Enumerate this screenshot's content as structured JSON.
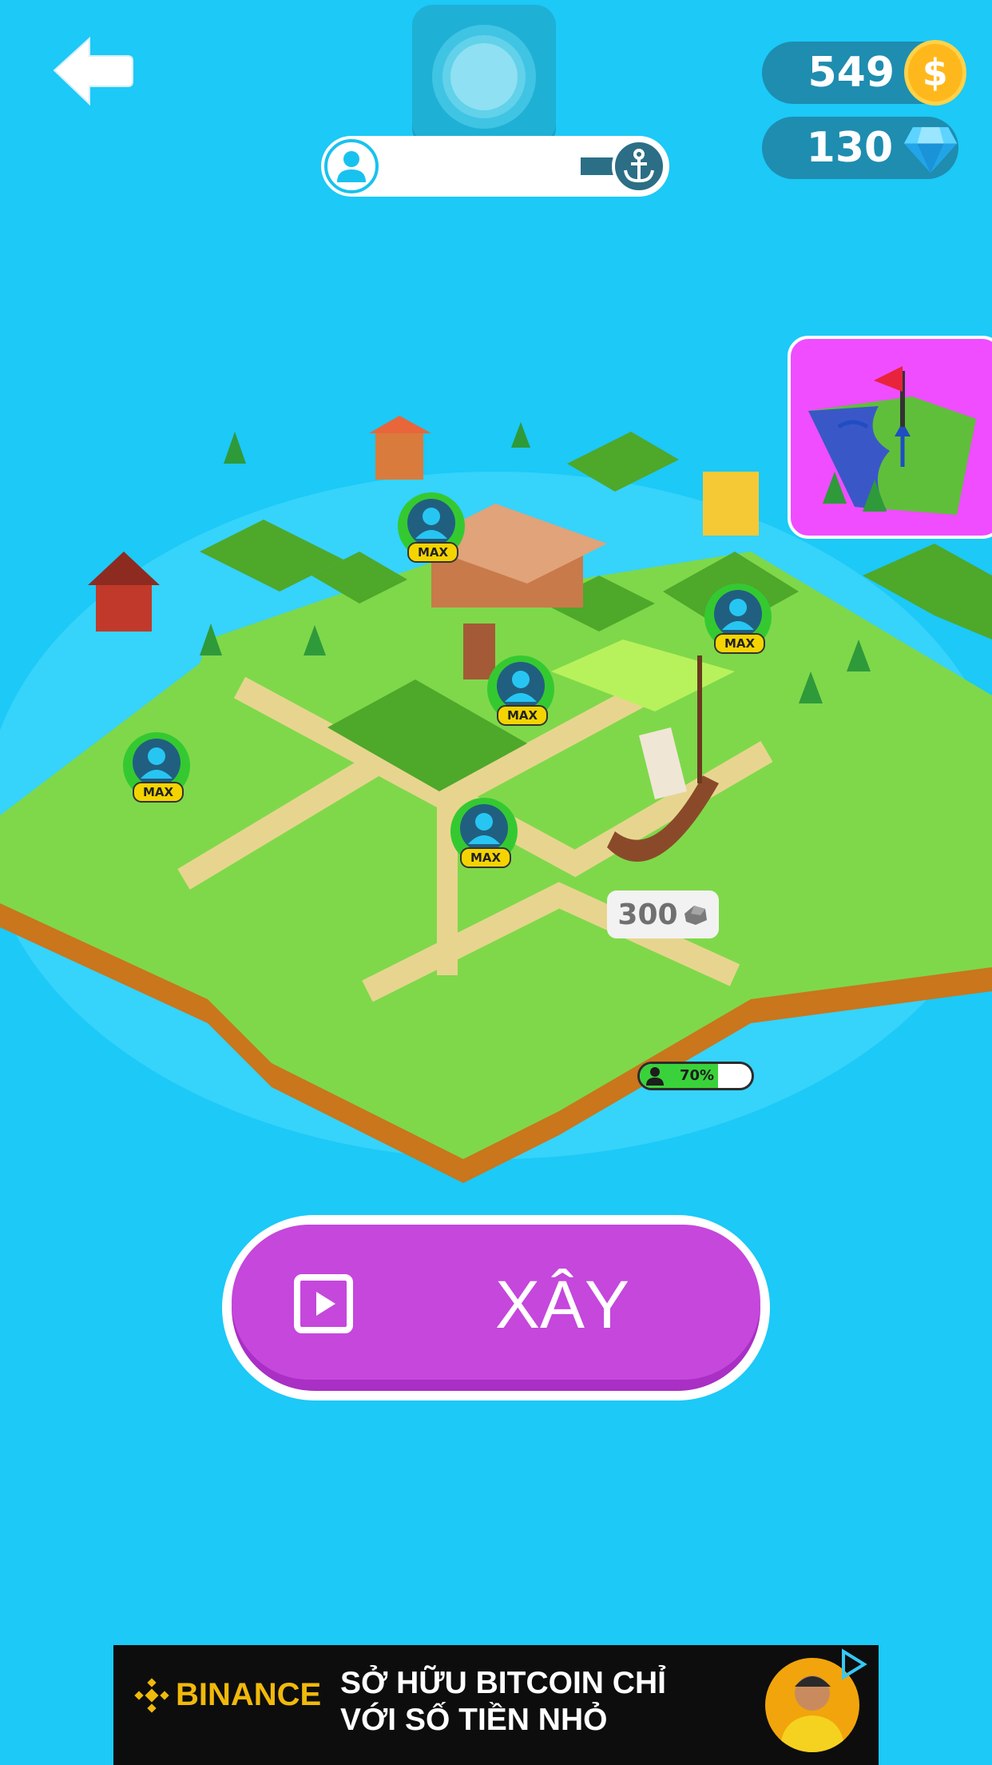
{
  "hud": {
    "coins": "549",
    "gems": "130",
    "ship_progress": 0.84
  },
  "island": {
    "workers": [
      {
        "badge": "MAX"
      },
      {
        "badge": "MAX"
      },
      {
        "badge": "MAX"
      },
      {
        "badge": "MAX"
      },
      {
        "badge": "MAX"
      }
    ],
    "plot_price": "300",
    "ship_capacity": "70%",
    "ship_capacity_level": 0.7
  },
  "build_button": {
    "label": "XÂY"
  },
  "ad": {
    "brand": "BINANCE",
    "line1": "SỞ HỮU BITCOIN CHỈ",
    "line2": "VỚI SỐ TIỀN NHỎ"
  },
  "colors": {
    "sea": "#1cc9f7",
    "grass": "#7fd84a",
    "build_button": "#c547dc",
    "map_button": "#ef4dff",
    "coin": "#ffb81c"
  }
}
